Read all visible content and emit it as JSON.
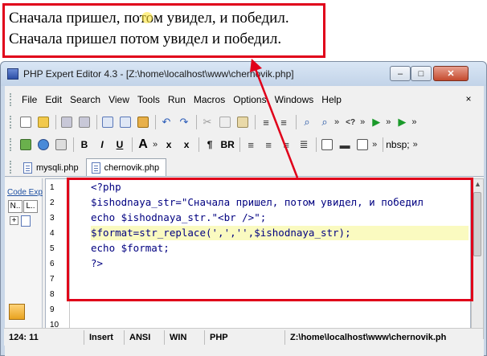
{
  "output": {
    "line1": "Сначала пришел, потом увидел, и победил.",
    "line2": "Сначала пришел потом увидел и победил."
  },
  "window": {
    "title": "PHP Expert Editor 4.3 - [Z:\\home\\localhost\\www\\chernovik.php]",
    "minimize": "–",
    "maximize": "□",
    "close": "✕"
  },
  "menu": [
    "File",
    "Edit",
    "Search",
    "View",
    "Tools",
    "Run",
    "Macros",
    "Options",
    "Windows",
    "Help"
  ],
  "menu_close": "×",
  "toolbar2": {
    "bold": "B",
    "italic": "I",
    "underline": "U",
    "font": "A",
    "subscript": "x",
    "superscript": "x",
    "paragraph": "¶",
    "br": "BR",
    "nbsp": "nbsp;"
  },
  "tabs": [
    {
      "label": "mysqli.php",
      "active": false
    },
    {
      "label": "chernovik.php",
      "active": true
    }
  ],
  "left_panel": {
    "label": "Code Exp",
    "tab_n": "N..",
    "tab_l": "L..",
    "expander": "+"
  },
  "editor": {
    "line_numbers": [
      "1",
      "2",
      "3",
      "4",
      "5",
      "6",
      "7",
      "8",
      "9",
      "10"
    ],
    "lines": [
      "<?php",
      "$ishodnaya_str=\"Сначала пришел, потом увидел, и победил",
      "echo $ishodnaya_str.\"<br />\";",
      "$format=str_replace(',','',$ishodnaya_str);",
      "echo $format;",
      "?>"
    ]
  },
  "status": {
    "position": "124: 11",
    "mode": "Insert",
    "encoding": "ANSI",
    "line_ending": "WIN",
    "language": "PHP",
    "path": "Z:\\home\\localhost\\www\\chernovik.ph"
  },
  "colors": {
    "annotation_red": "#e0001a",
    "code_blue": "#000080",
    "function_green": "#006400",
    "current_line": "#fafac0"
  }
}
